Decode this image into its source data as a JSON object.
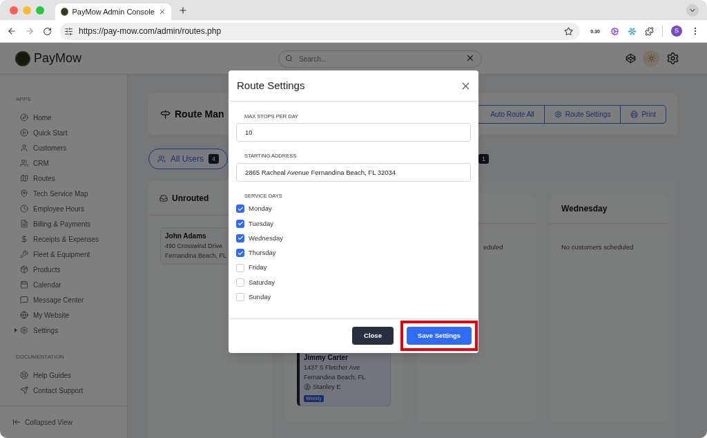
{
  "browser": {
    "tab_title": "PayMow Admin Console",
    "url": "https://pay-mow.com/admin/routes.php",
    "extension_badge": "0.30",
    "profile_initial": "S"
  },
  "app": {
    "logo": "PayMow",
    "search": {
      "placeholder": "Search..."
    }
  },
  "sidebar": {
    "sections": [
      {
        "heading": "APPS",
        "items": [
          {
            "label": "Home"
          },
          {
            "label": "Quick Start"
          },
          {
            "label": "Customers"
          },
          {
            "label": "CRM"
          },
          {
            "label": "Routes"
          },
          {
            "label": "Tech Service Map"
          },
          {
            "label": "Employee Hours"
          },
          {
            "label": "Billing & Payments"
          },
          {
            "label": "Receipts & Expenses"
          },
          {
            "label": "Fleet & Equipment"
          },
          {
            "label": "Products"
          },
          {
            "label": "Calendar"
          },
          {
            "label": "Message Center"
          },
          {
            "label": "My Website"
          },
          {
            "label": "Settings",
            "expanded": false
          }
        ]
      },
      {
        "heading": "DOCUMENTATION",
        "items": [
          {
            "label": "Help Guides"
          },
          {
            "label": "Contact Support"
          }
        ]
      }
    ],
    "footer": "Collapsed View"
  },
  "page": {
    "title": "Route Man",
    "actions": [
      "Auto Route All",
      "Route Settings",
      "Print"
    ],
    "filters": [
      {
        "label": "All Users",
        "count": "4",
        "selected": true
      },
      {
        "count": "1",
        "selected": false
      }
    ],
    "columns": [
      {
        "title": "Unrouted",
        "cards": [
          {
            "name": "John Adams",
            "lines": [
              "490 Crosswind Drive",
              "Fernandina Beach, FL"
            ]
          }
        ]
      },
      {
        "cards": [
          {
            "name": "Jimmy Carter",
            "lines": [
              "1437 S Fletcher Ave",
              "Fernandina Beach, FL"
            ],
            "tech": "Stanley E",
            "tag": "Weekly"
          }
        ]
      },
      {
        "empty_text": "eduled"
      },
      {
        "title": "Wednesday",
        "empty_text": "No customers scheduled"
      }
    ]
  },
  "modal": {
    "title": "Route Settings",
    "fields": [
      {
        "label": "MAX STOPS PER DAY",
        "value": "10"
      },
      {
        "label": "STARTING ADDRESS",
        "value": "2865 Racheal Avenue Fernandina Beach, FL 32034"
      }
    ],
    "days_label": "SERVICE DAYS",
    "days": [
      {
        "label": "Monday",
        "checked": true
      },
      {
        "label": "Tuesday",
        "checked": true
      },
      {
        "label": "Wednesday",
        "checked": true
      },
      {
        "label": "Thursday",
        "checked": true
      },
      {
        "label": "Friday",
        "checked": false
      },
      {
        "label": "Saturday",
        "checked": false
      },
      {
        "label": "Sunday",
        "checked": false
      }
    ],
    "buttons": [
      {
        "label": "Close",
        "kind": "secondary",
        "highlighted": false
      },
      {
        "label": "Save Settings",
        "kind": "primary",
        "highlighted": true
      }
    ]
  }
}
